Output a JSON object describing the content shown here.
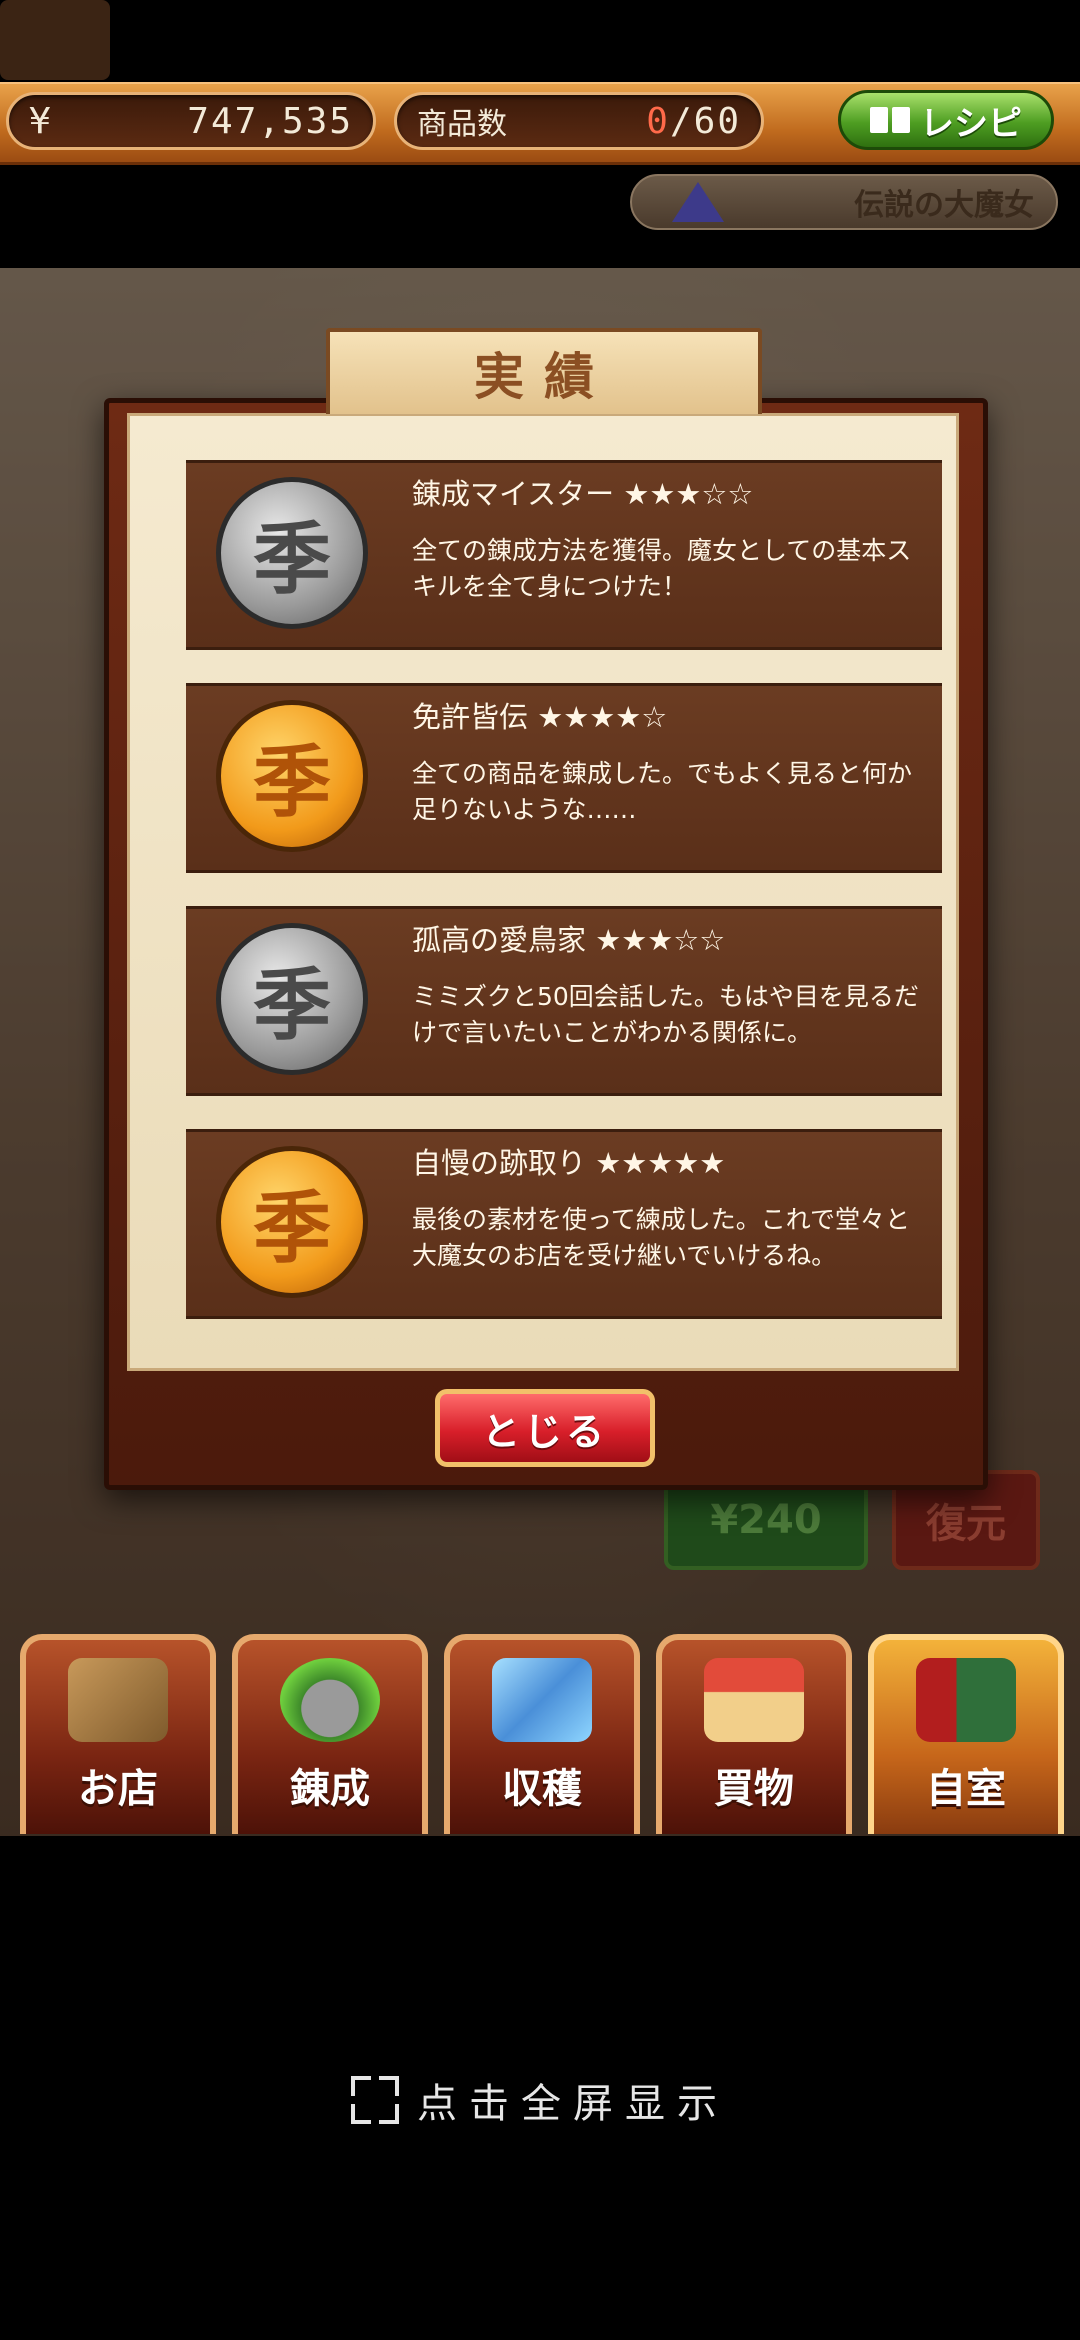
{
  "topbar": {
    "currency_symbol": "¥",
    "money": "747,535",
    "goods_label": "商品数",
    "goods_current": "0",
    "goods_max": "/60",
    "recipe_label": "レシピ"
  },
  "title_bar": {
    "title": "伝説の大魔女",
    "icon": "witch-hat-icon"
  },
  "dialog": {
    "header": "実績",
    "entries": [
      {
        "coin": "silver",
        "coin_glyph": "季",
        "title": "錬成マイスター ★★★☆☆",
        "description": "全ての錬成方法を獲得。魔女としての基本スキルを全て身につけた！"
      },
      {
        "coin": "gold",
        "coin_glyph": "季",
        "title": "免許皆伝 ★★★★☆",
        "description": "全ての商品を錬成した。でもよく見ると何か足りないような……"
      },
      {
        "coin": "silver",
        "coin_glyph": "季",
        "title": "孤高の愛鳥家 ★★★☆☆",
        "description": "ミミズクと50回会話した。もはや目を見るだけで言いたいことがわかる関係に。"
      },
      {
        "coin": "gold",
        "coin_glyph": "季",
        "title": "自慢の跡取り ★★★★★",
        "description": "最後の素材を使って練成した。これで堂々と大魔女のお店を受け継いでいけるね。"
      }
    ],
    "close_label": "とじる"
  },
  "background": {
    "price_label": "¥240",
    "restore_label": "復元"
  },
  "nav": {
    "items": [
      {
        "label": "お店",
        "icon": "shop-icon",
        "active": false
      },
      {
        "label": "錬成",
        "icon": "cauldron-icon",
        "active": false
      },
      {
        "label": "収穫",
        "icon": "crystal-icon",
        "active": false
      },
      {
        "label": "買物",
        "icon": "house-icon",
        "active": false
      },
      {
        "label": "自室",
        "icon": "lamp-book-icon",
        "active": true
      }
    ]
  },
  "fullscreen": {
    "label": "点击全屏显示",
    "icon": "expand-icon"
  },
  "colors": {
    "accent_orange": "#c06b1e",
    "recipe_green": "#4e9e22",
    "close_red": "#d81f2a",
    "panel_brown": "#5a2f19"
  }
}
